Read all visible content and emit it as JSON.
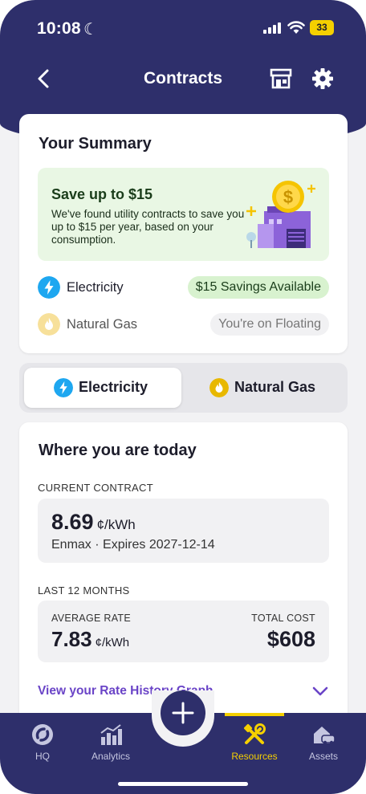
{
  "status": {
    "time": "10:08",
    "battery": "33"
  },
  "nav": {
    "title": "Contracts"
  },
  "summary": {
    "title": "Your Summary",
    "promo_title": "Save up to $15",
    "promo_desc": "We've found utility contracts to save you up to $15 per year, based on your consumption.",
    "rows": [
      {
        "label": "Electricity",
        "pill": "$15 Savings Available"
      },
      {
        "label": "Natural Gas",
        "pill": "You're on Floating"
      }
    ]
  },
  "toggle": {
    "options": [
      "Electricity",
      "Natural Gas"
    ],
    "selected": "Electricity"
  },
  "today": {
    "title": "Where you are today",
    "current_label": "CURRENT CONTRACT",
    "current_rate": "8.69",
    "current_unit": "¢/kWh",
    "current_sub": "Enmax · Expires 2027-12-14",
    "last_label": "LAST 12 MONTHS",
    "avg_label": "AVERAGE RATE",
    "avg_rate": "7.83",
    "avg_unit": "¢/kWh",
    "total_label": "TOTAL COST",
    "total_cost": "$608",
    "link": "View your Rate History Graph"
  },
  "tabs": [
    {
      "label": "HQ",
      "icon": "hq-icon"
    },
    {
      "label": "Analytics",
      "icon": "analytics-icon"
    },
    {
      "label": "Resources",
      "icon": "tools-icon"
    },
    {
      "label": "Assets",
      "icon": "house-car-icon"
    }
  ],
  "active_tab": "Resources",
  "colors": {
    "brand": "#2e2f6b",
    "accent_yellow": "#f5d000",
    "electric_blue": "#1ea7f0",
    "savings_green": "#d8f2cf",
    "link_purple": "#6a44c7"
  }
}
